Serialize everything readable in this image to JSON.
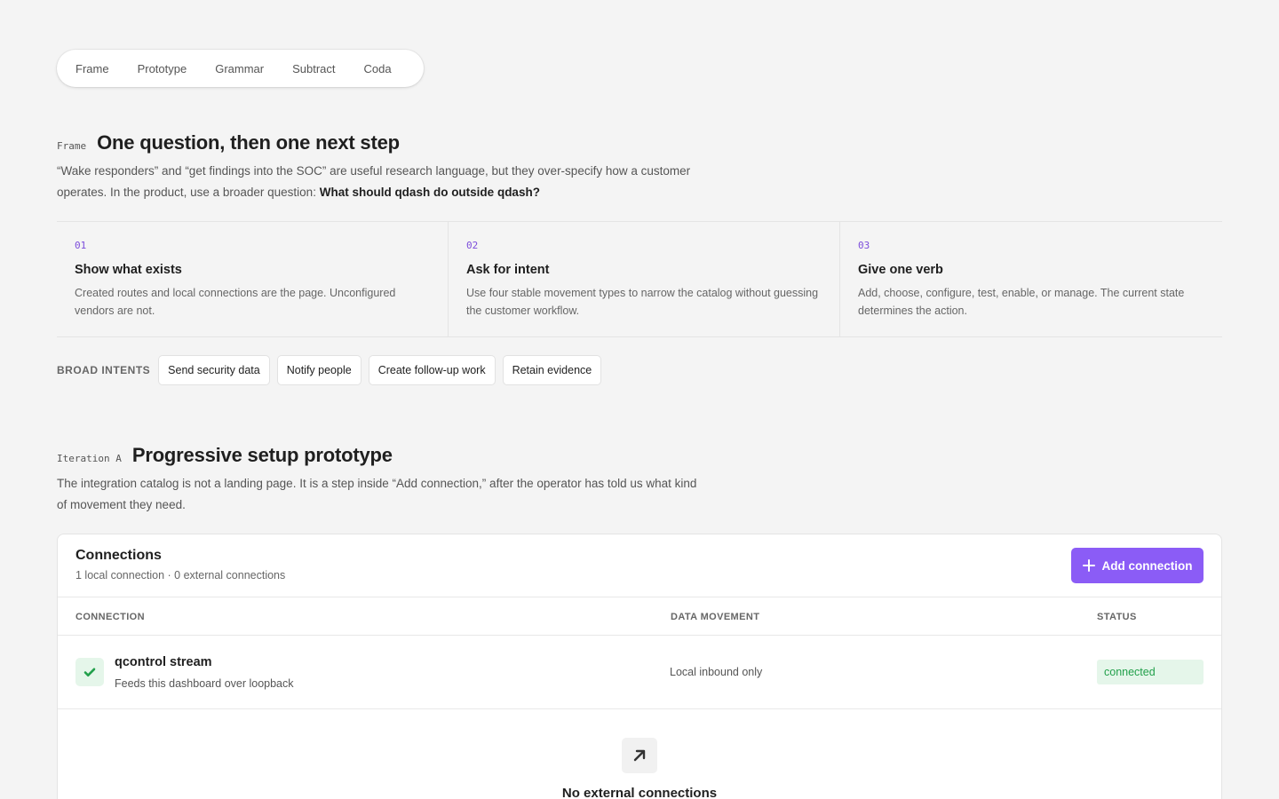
{
  "nav": {
    "items": [
      "Frame",
      "Prototype",
      "Grammar",
      "Subtract",
      "Coda"
    ]
  },
  "frame": {
    "eyebrow": "Frame",
    "heading": "One question, then one next step",
    "lede": "“Wake responders” and “get findings into the SOC” are useful research language, but they over-specify how a customer operates. In the product, use a broader question: ",
    "lede_strong": "What should qdash do outside qdash?"
  },
  "steps": [
    {
      "num": "01",
      "title": "Show what exists",
      "body": "Created routes and local connections are the page. Unconfigured vendors are not."
    },
    {
      "num": "02",
      "title": "Ask for intent",
      "body": "Use four stable movement types to narrow the catalog without guessing the customer workflow."
    },
    {
      "num": "03",
      "title": "Give one verb",
      "body": "Add, choose, configure, test, enable, or manage. The current state determines the action."
    }
  ],
  "intents": {
    "label": "BROAD INTENTS",
    "chips": [
      "Send security data",
      "Notify people",
      "Create follow-up work",
      "Retain evidence"
    ]
  },
  "iteration": {
    "eyebrow": "Iteration A",
    "heading": "Progressive setup prototype",
    "lede": "The integration catalog is not a landing page. It is a step inside “Add connection,” after the operator has told us what kind of movement they need."
  },
  "connections": {
    "title": "Connections",
    "subtitle": "1 local connection · 0 external connections",
    "add_label": "Add connection",
    "columns": [
      "CONNECTION",
      "DATA MOVEMENT",
      "STATUS"
    ],
    "rows": [
      {
        "icon": "check-icon",
        "name": "qcontrol stream",
        "description": "Feeds this dashboard over loopback",
        "movement": "Local inbound only",
        "status": "connected"
      }
    ],
    "empty": {
      "icon": "arrow-up-right-icon",
      "title": "No external connections"
    }
  },
  "colors": {
    "accent": "#8b5cf6",
    "step_number": "#7c4ddb",
    "success_bg": "#e5f6ea",
    "success_text": "#22a04b",
    "page_bg": "#f4f4f4"
  }
}
